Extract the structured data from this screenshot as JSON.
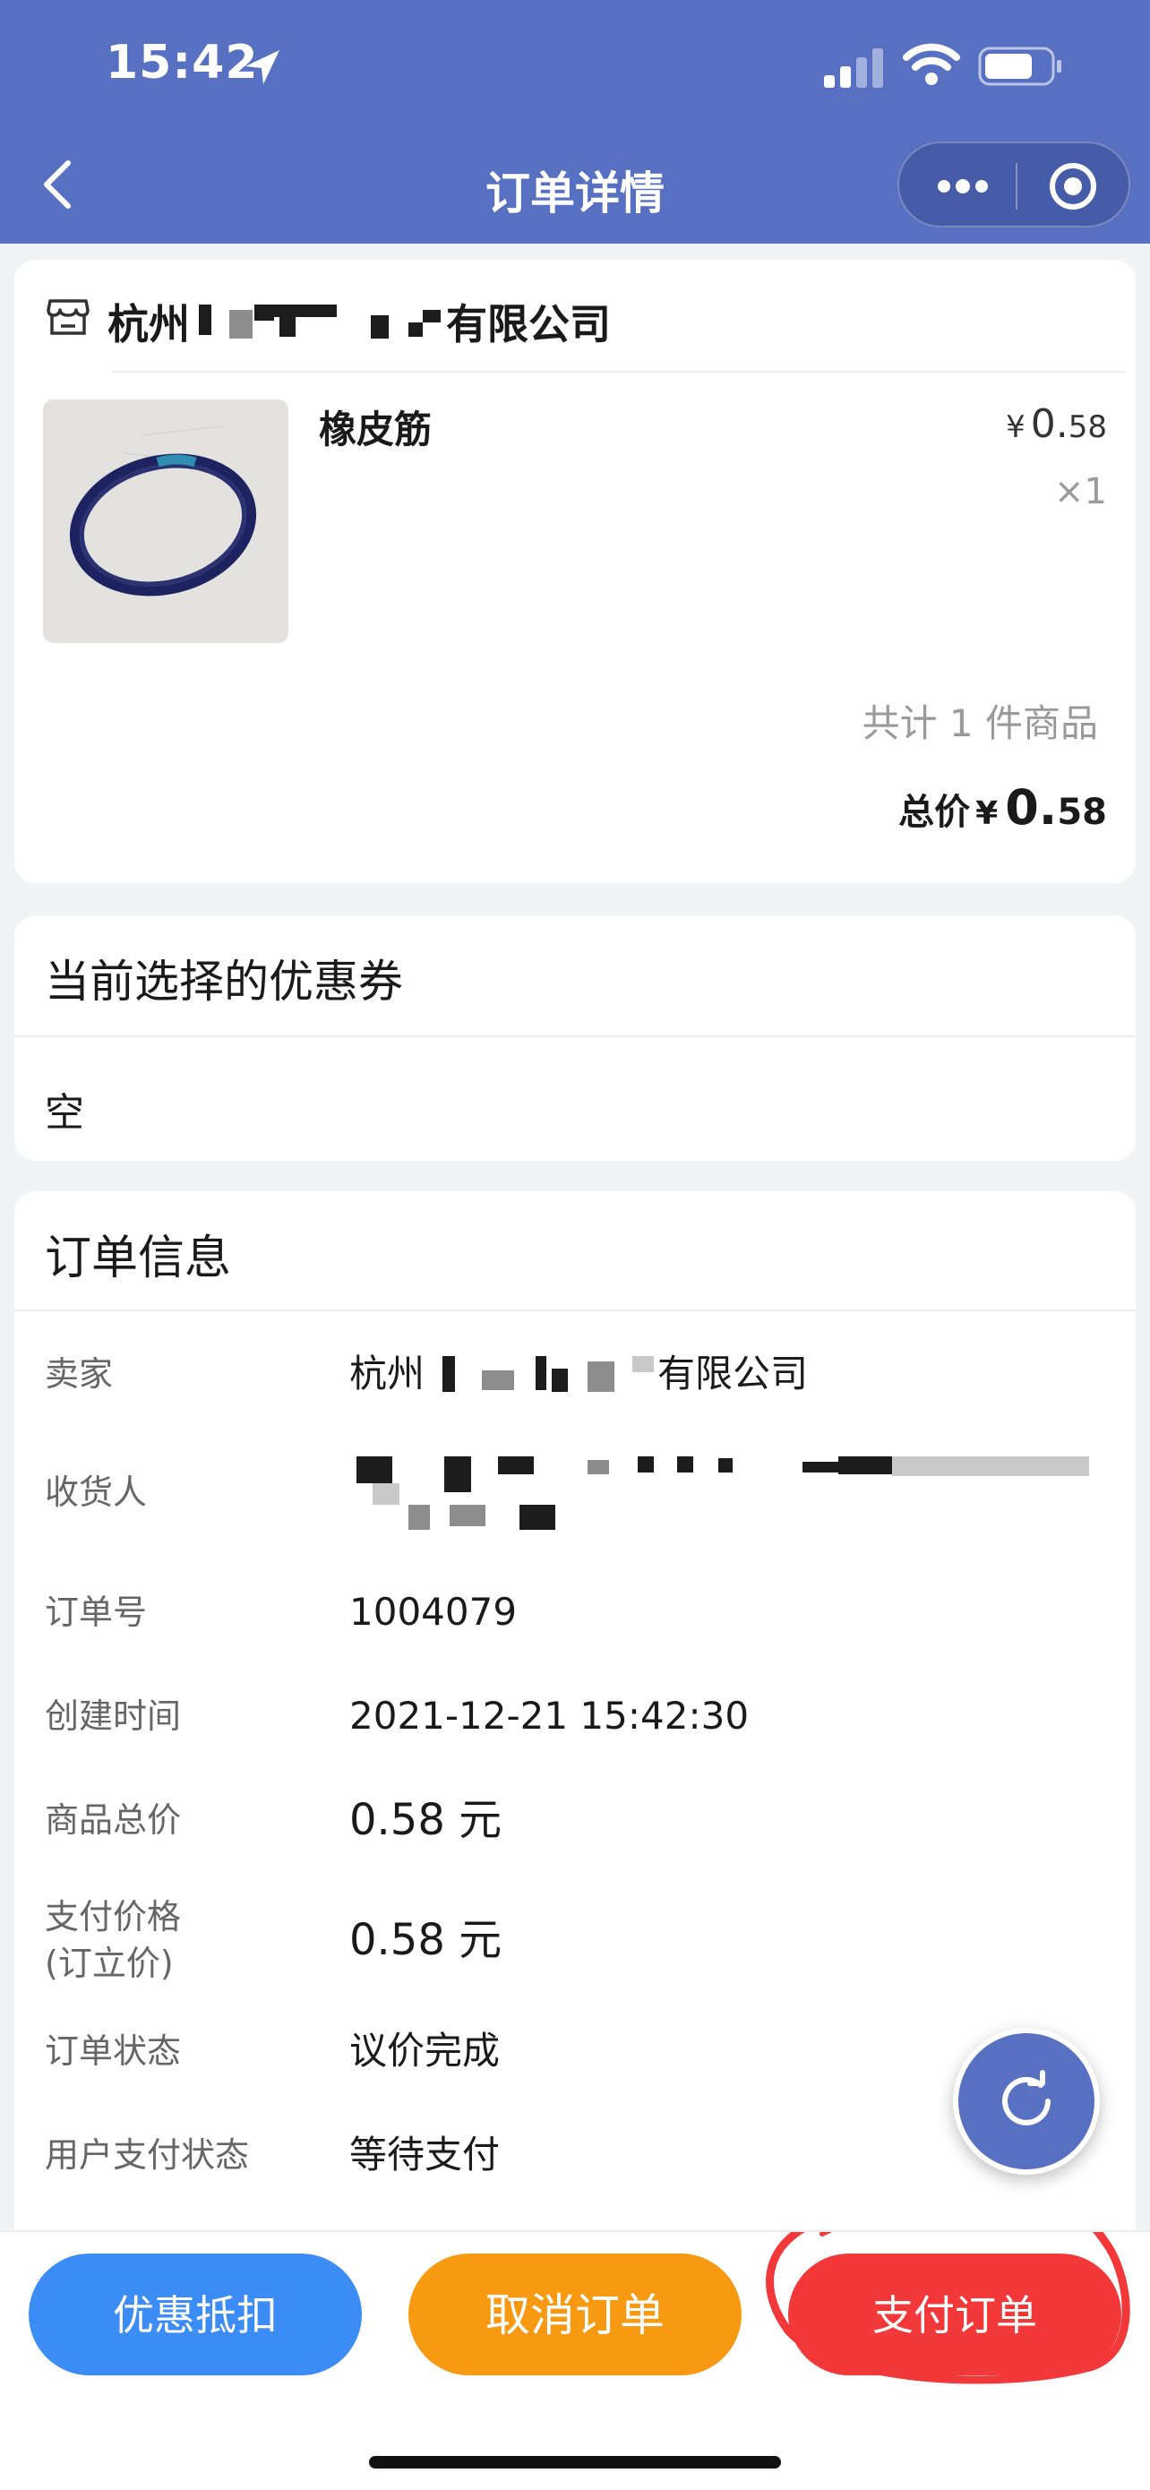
{
  "status_bar": {
    "time": "15:42"
  },
  "nav": {
    "title": "订单详情"
  },
  "shop": {
    "name_prefix": "杭州",
    "name_suffix": "有限公司",
    "product": {
      "name": "橡皮筋",
      "price_symbol": "¥",
      "price_int": "0.",
      "price_dec": "58",
      "qty": "×1"
    },
    "item_count": "共计 1 件商品",
    "total_label": "总价",
    "total_symbol": "¥",
    "total_int": "0.",
    "total_dec": "58"
  },
  "coupon": {
    "title": "当前选择的优惠券",
    "value": "空"
  },
  "order_info": {
    "title": "订单信息",
    "seller_label": "卖家",
    "seller_prefix": "杭州",
    "seller_suffix": "有限公司",
    "receiver_label": "收货人",
    "order_no_label": "订单号",
    "order_no": "1004079",
    "created_label": "创建时间",
    "created": "2021-12-21 15:42:30",
    "goods_total_label": "商品总价",
    "goods_total": "0.58 元",
    "pay_price_label_1": "支付价格",
    "pay_price_label_2": "(订立价)",
    "pay_price": "0.58 元",
    "status_label": "订单状态",
    "status": "议价完成",
    "pay_status_label": "用户支付状态",
    "pay_status": "等待支付"
  },
  "actions": {
    "discount": "优惠抵扣",
    "cancel": "取消订单",
    "pay": "支付订单"
  },
  "colors": {
    "header": "#5770c2",
    "discount": "#3b8cf5",
    "cancel": "#f79a12",
    "pay": "#f23838"
  }
}
